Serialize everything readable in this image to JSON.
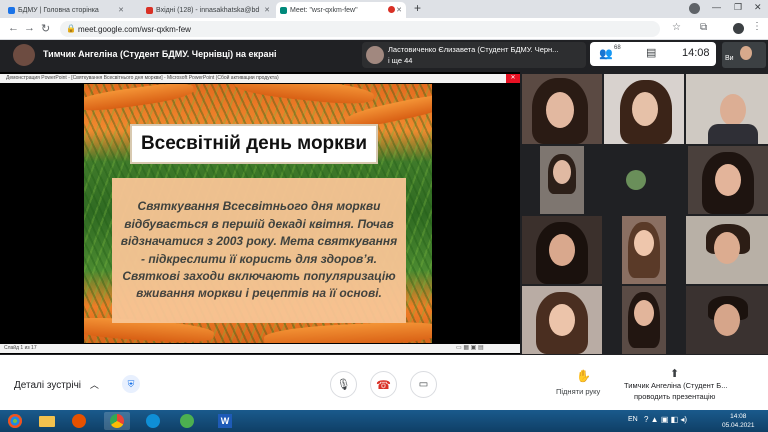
{
  "browser": {
    "tabs": [
      {
        "label": "БДМУ | Головна сторінка",
        "favicon_color": "#1a73e8"
      },
      {
        "label": "Вхідні (128) - innasakhatska@bd",
        "favicon_color": "#d93025"
      },
      {
        "label": "Meet: \"wsr-qxkm-few\"",
        "favicon_color": "#00897b"
      }
    ],
    "new_tab": "+",
    "url": "meet.google.com/wsr-qxkm-few"
  },
  "meet": {
    "presenter_title": "Тимчик Ангеліна (Студент БДМУ. Чернівці) на екрані",
    "others_line1": "Ластовиченко Єлизавета (Студент БДМУ. Черн...",
    "others_line2": "і ще 44",
    "people_count": "68",
    "time": "14:08",
    "self_label": "Ви"
  },
  "powerpoint": {
    "window_title": "Демонстрация PowerPoint - [Святкування Всесвітнього дня моркви] - Microsoft PowerPoint (Сбой активации продукта)",
    "status": "Слайд 1 из 17"
  },
  "slide": {
    "title": "Всесвітній день моркви",
    "body": "Святкування Всесвітнього дня моркви відбувається в першій декаді квітня. Почав відзначатися з 2003 року. Мета святкування - підкреслити її користь для здоров’я. Святкові заходи включають популяризацію вживання моркви і рецептів на її основі."
  },
  "controls": {
    "details_label": "Деталі зустрічі",
    "raise_hand_label": "Підняти руку",
    "presenting_line1": "Тимчик Ангеліна (Студент Б...",
    "presenting_line2": "проводить презентацію"
  },
  "taskbar": {
    "lang": "EN",
    "time": "14:08",
    "date": "05.04.2021"
  },
  "colors": {
    "meet_bg": "#202124",
    "hangup_red": "#d93025",
    "taskbar_blue": "#1a5a8c",
    "slide_title_bg": "#ffffff",
    "slide_body_bg": "#f8c595"
  }
}
